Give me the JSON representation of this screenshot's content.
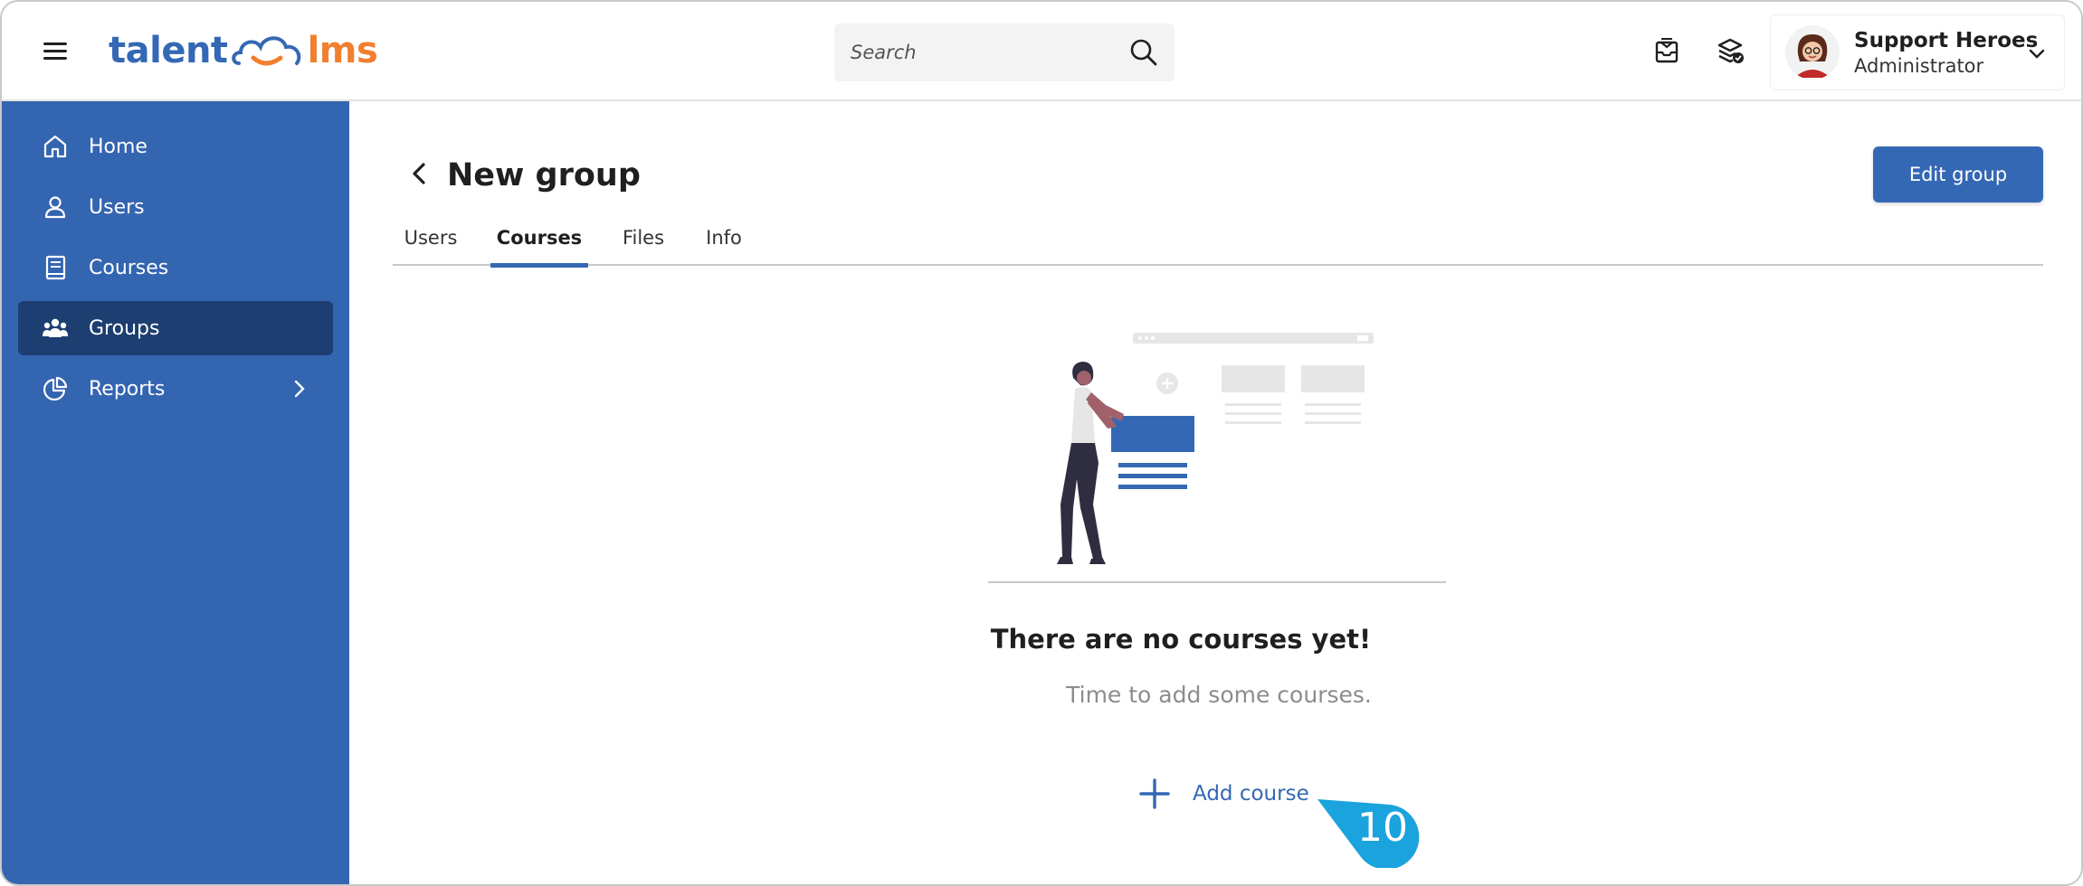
{
  "app": {
    "logo_text_left": "talent",
    "logo_text_right": "lms"
  },
  "header": {
    "search_placeholder": "Search",
    "user": {
      "name": "Support Heroes",
      "role": "Administrator"
    }
  },
  "sidebar": {
    "items": [
      {
        "label": "Home",
        "icon": "home-icon"
      },
      {
        "label": "Users",
        "icon": "user-icon"
      },
      {
        "label": "Courses",
        "icon": "book-icon"
      },
      {
        "label": "Groups",
        "icon": "groups-icon",
        "active": true
      },
      {
        "label": "Reports",
        "icon": "pie-chart-icon"
      }
    ]
  },
  "page": {
    "title": "New group",
    "edit_button": "Edit group",
    "tabs": [
      {
        "label": "Users"
      },
      {
        "label": "Courses",
        "active": true
      },
      {
        "label": "Files"
      },
      {
        "label": "Info"
      }
    ],
    "empty_title": "There are no courses yet!",
    "empty_subtitle": "Time to add some courses.",
    "add_course_label": "Add course",
    "step_badge": "10"
  },
  "colors": {
    "brand_blue": "#3468b4",
    "sidebar_bg": "#3465b1",
    "sidebar_active": "#1d3e70",
    "brand_orange": "#f07f2f",
    "badge_cyan": "#1aa3dc"
  }
}
